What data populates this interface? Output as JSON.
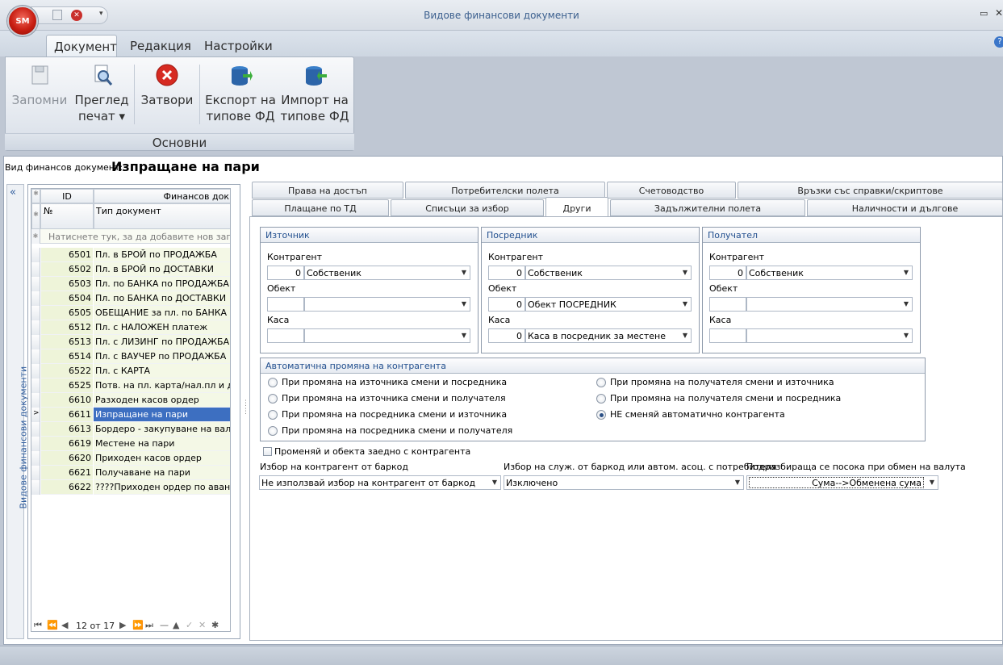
{
  "window": {
    "title": "Видове финансови документи",
    "orb_label": "SM"
  },
  "ribbon": {
    "tabs": [
      "Документ",
      "Редакция",
      "Настройки"
    ],
    "buttons": {
      "save": {
        "line1": "Запомни"
      },
      "preview": {
        "line1": "Преглед",
        "line2": "печат ▾"
      },
      "close": {
        "line1": "Затвори"
      },
      "export": {
        "line1": "Експорт на",
        "line2": "типове ФД"
      },
      "import": {
        "line1": "Импорт на",
        "line2": "типове ФД"
      }
    },
    "group_label": "Основни"
  },
  "doc_type": {
    "label": "Вид финансов документ:",
    "value": "Изпращане на пари"
  },
  "sidebar": {
    "title": "Видове финансови документи",
    "collapse_glyph": "«"
  },
  "grid": {
    "col_id": "ID",
    "col_fin": "Финансов док",
    "col_no": "№",
    "col_type": "Тип документ",
    "new_row_hint": "Натиснете тук, за да добавите нов запис",
    "rows": [
      {
        "id": "6501",
        "name": "Пл. в БРОЙ по ПРОДАЖБА"
      },
      {
        "id": "6502",
        "name": "Пл. в БРОЙ по ДОСТАВКИ"
      },
      {
        "id": "6503",
        "name": "Пл. по БАНКА по ПРОДАЖБА"
      },
      {
        "id": "6504",
        "name": "Пл. по БАНКА по ДОСТАВКИ"
      },
      {
        "id": "6505",
        "name": "ОБЕЩАНИЕ за пл. по БАНКА"
      },
      {
        "id": "6512",
        "name": "Пл. с НАЛОЖЕН платеж"
      },
      {
        "id": "6513",
        "name": "Пл. с ЛИЗИНГ по ПРОДАЖБА"
      },
      {
        "id": "6514",
        "name": "Пл. с ВАУЧЕР по ПРОДАЖБА"
      },
      {
        "id": "6522",
        "name": "Пл. с КАРТА"
      },
      {
        "id": "6525",
        "name": "Потв. на пл. карта/нал.пл и др"
      },
      {
        "id": "6610",
        "name": "Разходен касов ордер"
      },
      {
        "id": "6611",
        "name": "Изпращане на пари"
      },
      {
        "id": "6613",
        "name": "Бордеро - закупуване на валута"
      },
      {
        "id": "6619",
        "name": "Местене на пари"
      },
      {
        "id": "6620",
        "name": "Приходен касов ордер"
      },
      {
        "id": "6621",
        "name": "Получаване на пари"
      },
      {
        "id": "6622",
        "name": "????Приходен ордер по аванс"
      }
    ],
    "nav": {
      "first": "⏮",
      "prev_page": "⏪",
      "prev": "◀",
      "position": "12 от 17",
      "next": "▶",
      "next_page": "⏩",
      "last": "⏭",
      "delete": "—",
      "up": "▲",
      "confirm": "✓",
      "cancel": "✕",
      "star": "✱"
    }
  },
  "tabs": {
    "row1": [
      "Права на достъп",
      "Потребителски полета",
      "Счетоводство",
      "Връзки със справки/скриптове"
    ],
    "row2": [
      "Плащане по ТД",
      "Списъци за избор",
      "Други",
      "Задължителни полета",
      "Наличности и дългове"
    ],
    "active": "Други"
  },
  "panel": {
    "groups": [
      {
        "title": "Източник",
        "kontragent_label": "Контрагент",
        "kontragent_num": "0",
        "kontragent_val": "Собственик",
        "obekt_label": "Обект",
        "obekt_num": "",
        "obekt_val": "",
        "kasa_label": "Каса",
        "kasa_num": "",
        "kasa_val": ""
      },
      {
        "title": "Посредник",
        "kontragent_label": "Контрагент",
        "kontragent_num": "0",
        "kontragent_val": "Собственик",
        "obekt_label": "Обект",
        "obekt_num": "0",
        "obekt_val": "Обект ПОСРЕДНИК",
        "kasa_label": "Каса",
        "kasa_num": "0",
        "kasa_val": "Каса в посредник за местене"
      },
      {
        "title": "Получател",
        "kontragent_label": "Контрагент",
        "kontragent_num": "0",
        "kontragent_val": "Собственик",
        "obekt_label": "Обект",
        "obekt_num": "",
        "obekt_val": "",
        "kasa_label": "Каса",
        "kasa_num": "",
        "kasa_val": ""
      }
    ],
    "auto_change": {
      "title": "Автоматична промяна на контрагента",
      "options_left": [
        "При промяна на източника смени и посредника",
        "При промяна на източника смени и получателя",
        "При промяна на посредника смени и източника",
        "При промяна на посредника смени и получателя"
      ],
      "options_right": [
        "При промяна на получателя смени и източника",
        "При промяна на получателя смени и посредника",
        "НЕ сменяй автоматично контрагента"
      ],
      "selected": "НЕ сменяй автоматично контрагента"
    },
    "change_object_checkbox": {
      "label": "Променяй и обекта заедно с контрагента",
      "checked": false
    },
    "barcode_select": {
      "label": "Избор на контрагент от баркод",
      "value": "Не използвай избор на контрагент от баркод"
    },
    "employee_select": {
      "label": "Избор на служ. от баркод или автом. асоц. с потребителя",
      "value": "Изключено"
    },
    "currency_select": {
      "label": "Подразбираща се посока при обмен на валута",
      "value": "Сума-->Обменена сума"
    }
  },
  "colors": {
    "accent": "#3d6fc1",
    "group_title": "#23508f",
    "title_text": "#3b5f8e",
    "grid_id_bg": "#eef4d9"
  }
}
